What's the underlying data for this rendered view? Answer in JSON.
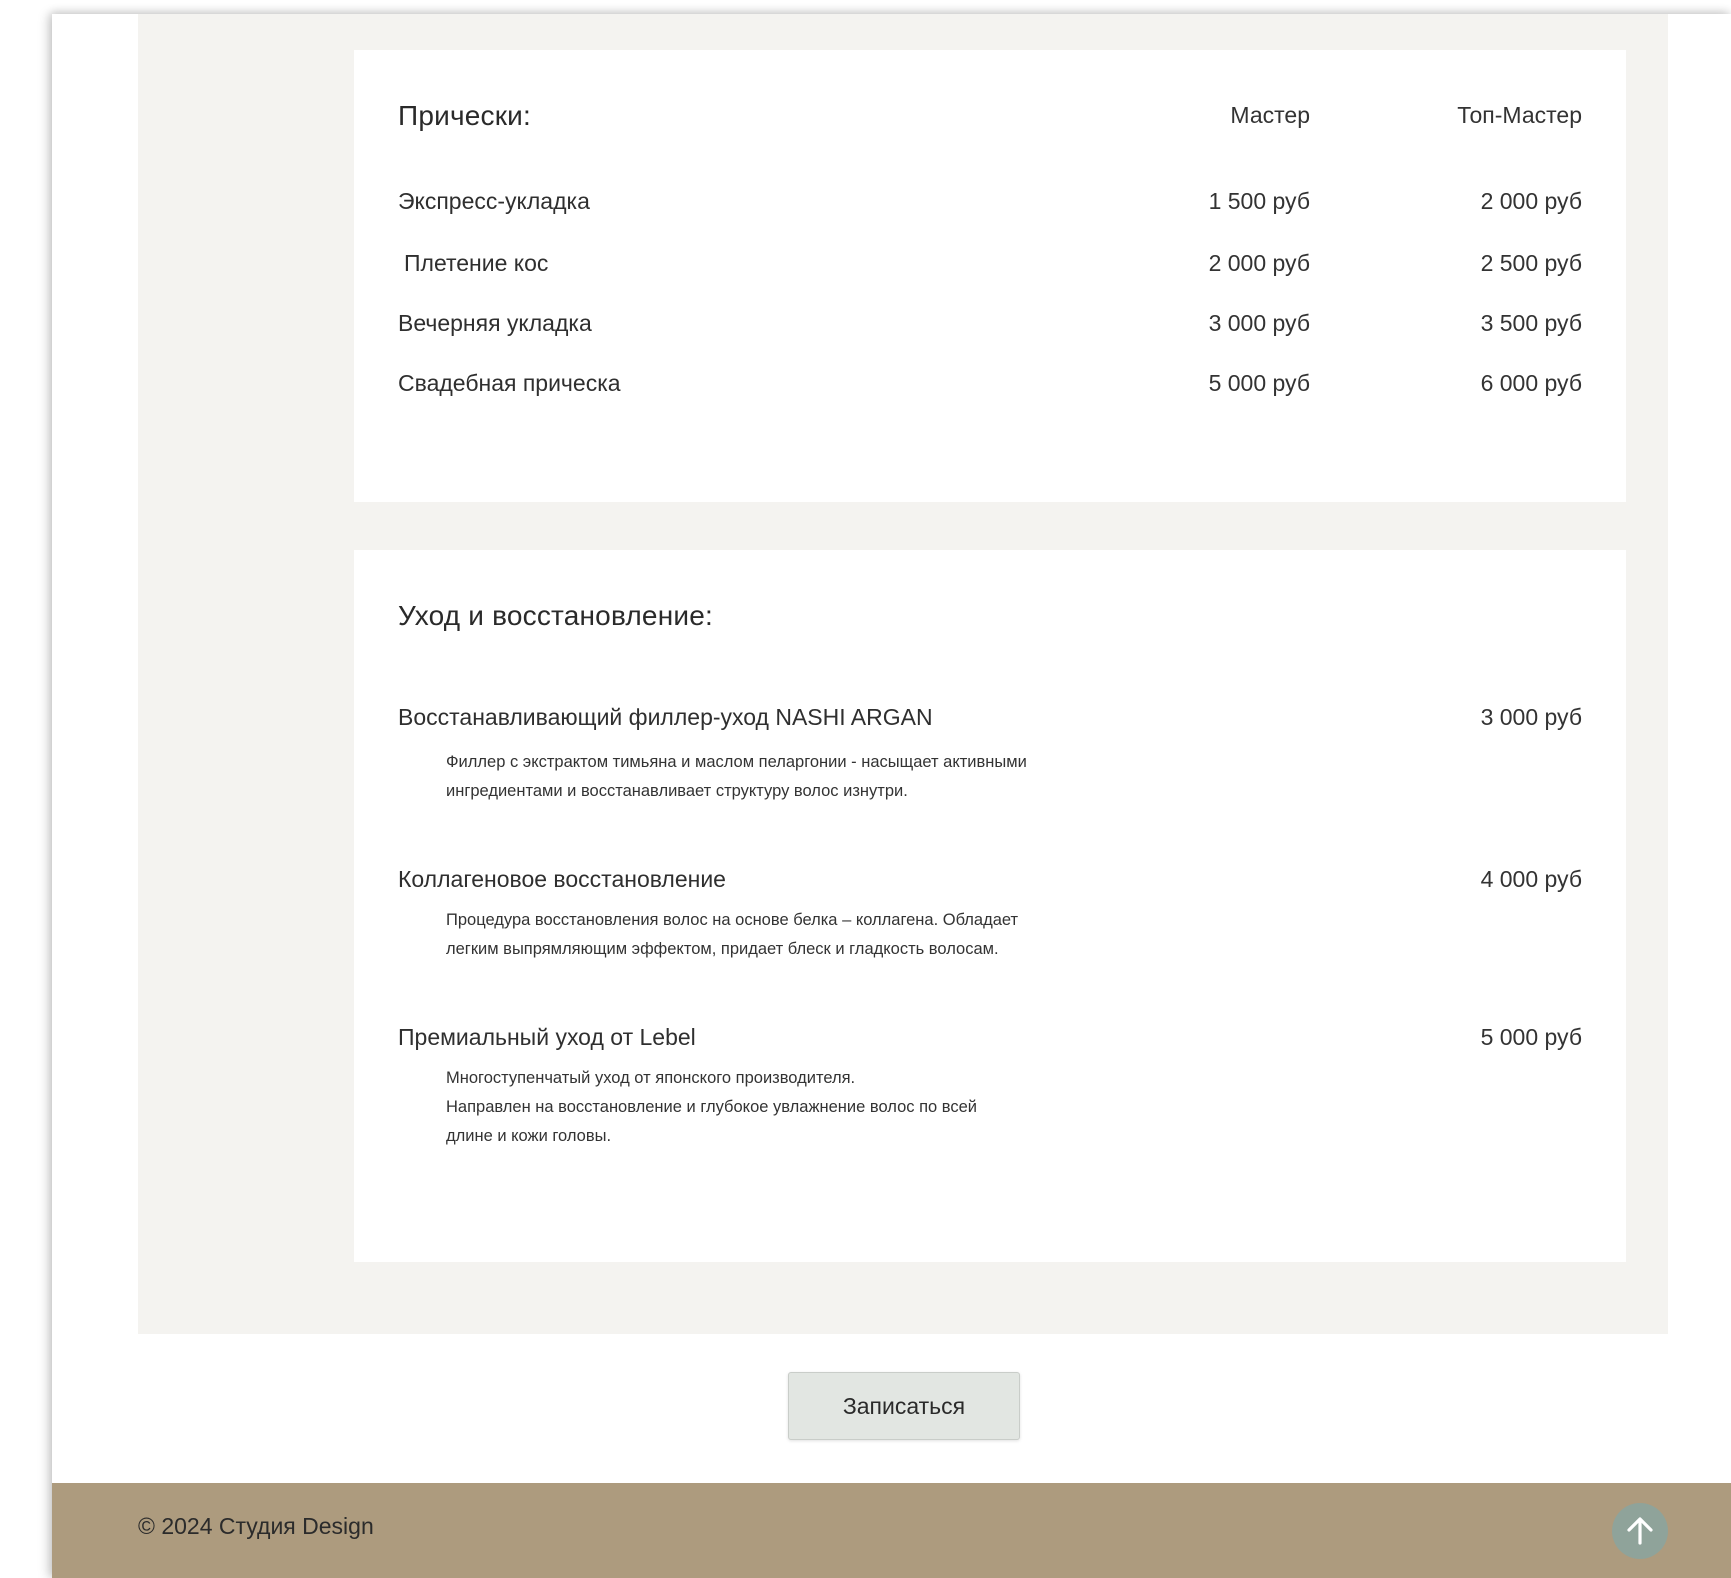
{
  "hair": {
    "title": "Прически:",
    "col_master": "Мастер",
    "col_top_master": "Топ-Мастер",
    "rows": [
      {
        "name": "Экспресс-укладка",
        "master": "1 500 руб",
        "top": "2 000 руб"
      },
      {
        "name": "Плетение кос",
        "master": "2 000 руб",
        "top": "2 500 руб"
      },
      {
        "name": "Вечерняя укладка",
        "master": "3 000 руб",
        "top": "3 500 руб"
      },
      {
        "name": "Свадебная прическа",
        "master": "5 000 руб",
        "top": "6 000 руб"
      }
    ]
  },
  "care": {
    "title": "Уход и восстановление:",
    "items": [
      {
        "name": "Восстанавливающий филлер-уход NASHI ARGAN",
        "price": "3 000 руб",
        "desc_lines": [
          "Филлер с экстрактом тимьяна и маслом пеларгонии - насыщает активными",
          "ингредиентами и восстанавливает структуру волос изнутри."
        ]
      },
      {
        "name": "Коллагеновое восстановление",
        "price": "4 000 руб",
        "desc_lines": [
          "Процедура восстановления волос на основе белка – коллагена. Обладает",
          "легким выпрямляющим эффектом, придает блеск и гладкость волосам."
        ]
      },
      {
        "name": "Премиальный уход от Lebel",
        "price": "5 000 руб",
        "desc_lines": [
          "Многоступенчатый уход от японского производителя.",
          "Направлен на восстановление и глубокое увлажнение волос по всей",
          "длине и кожи головы."
        ]
      }
    ]
  },
  "book_button": "Записаться",
  "footer": {
    "copyright": "© 2024 Студия Design",
    "to_top_icon": "arrow-up-icon"
  },
  "colors": {
    "section_bg": "#f4f3f0",
    "footer_bg": "#ad9b7e",
    "button_bg": "#e2e6e2",
    "to_top_bg": "#8fa39a"
  }
}
